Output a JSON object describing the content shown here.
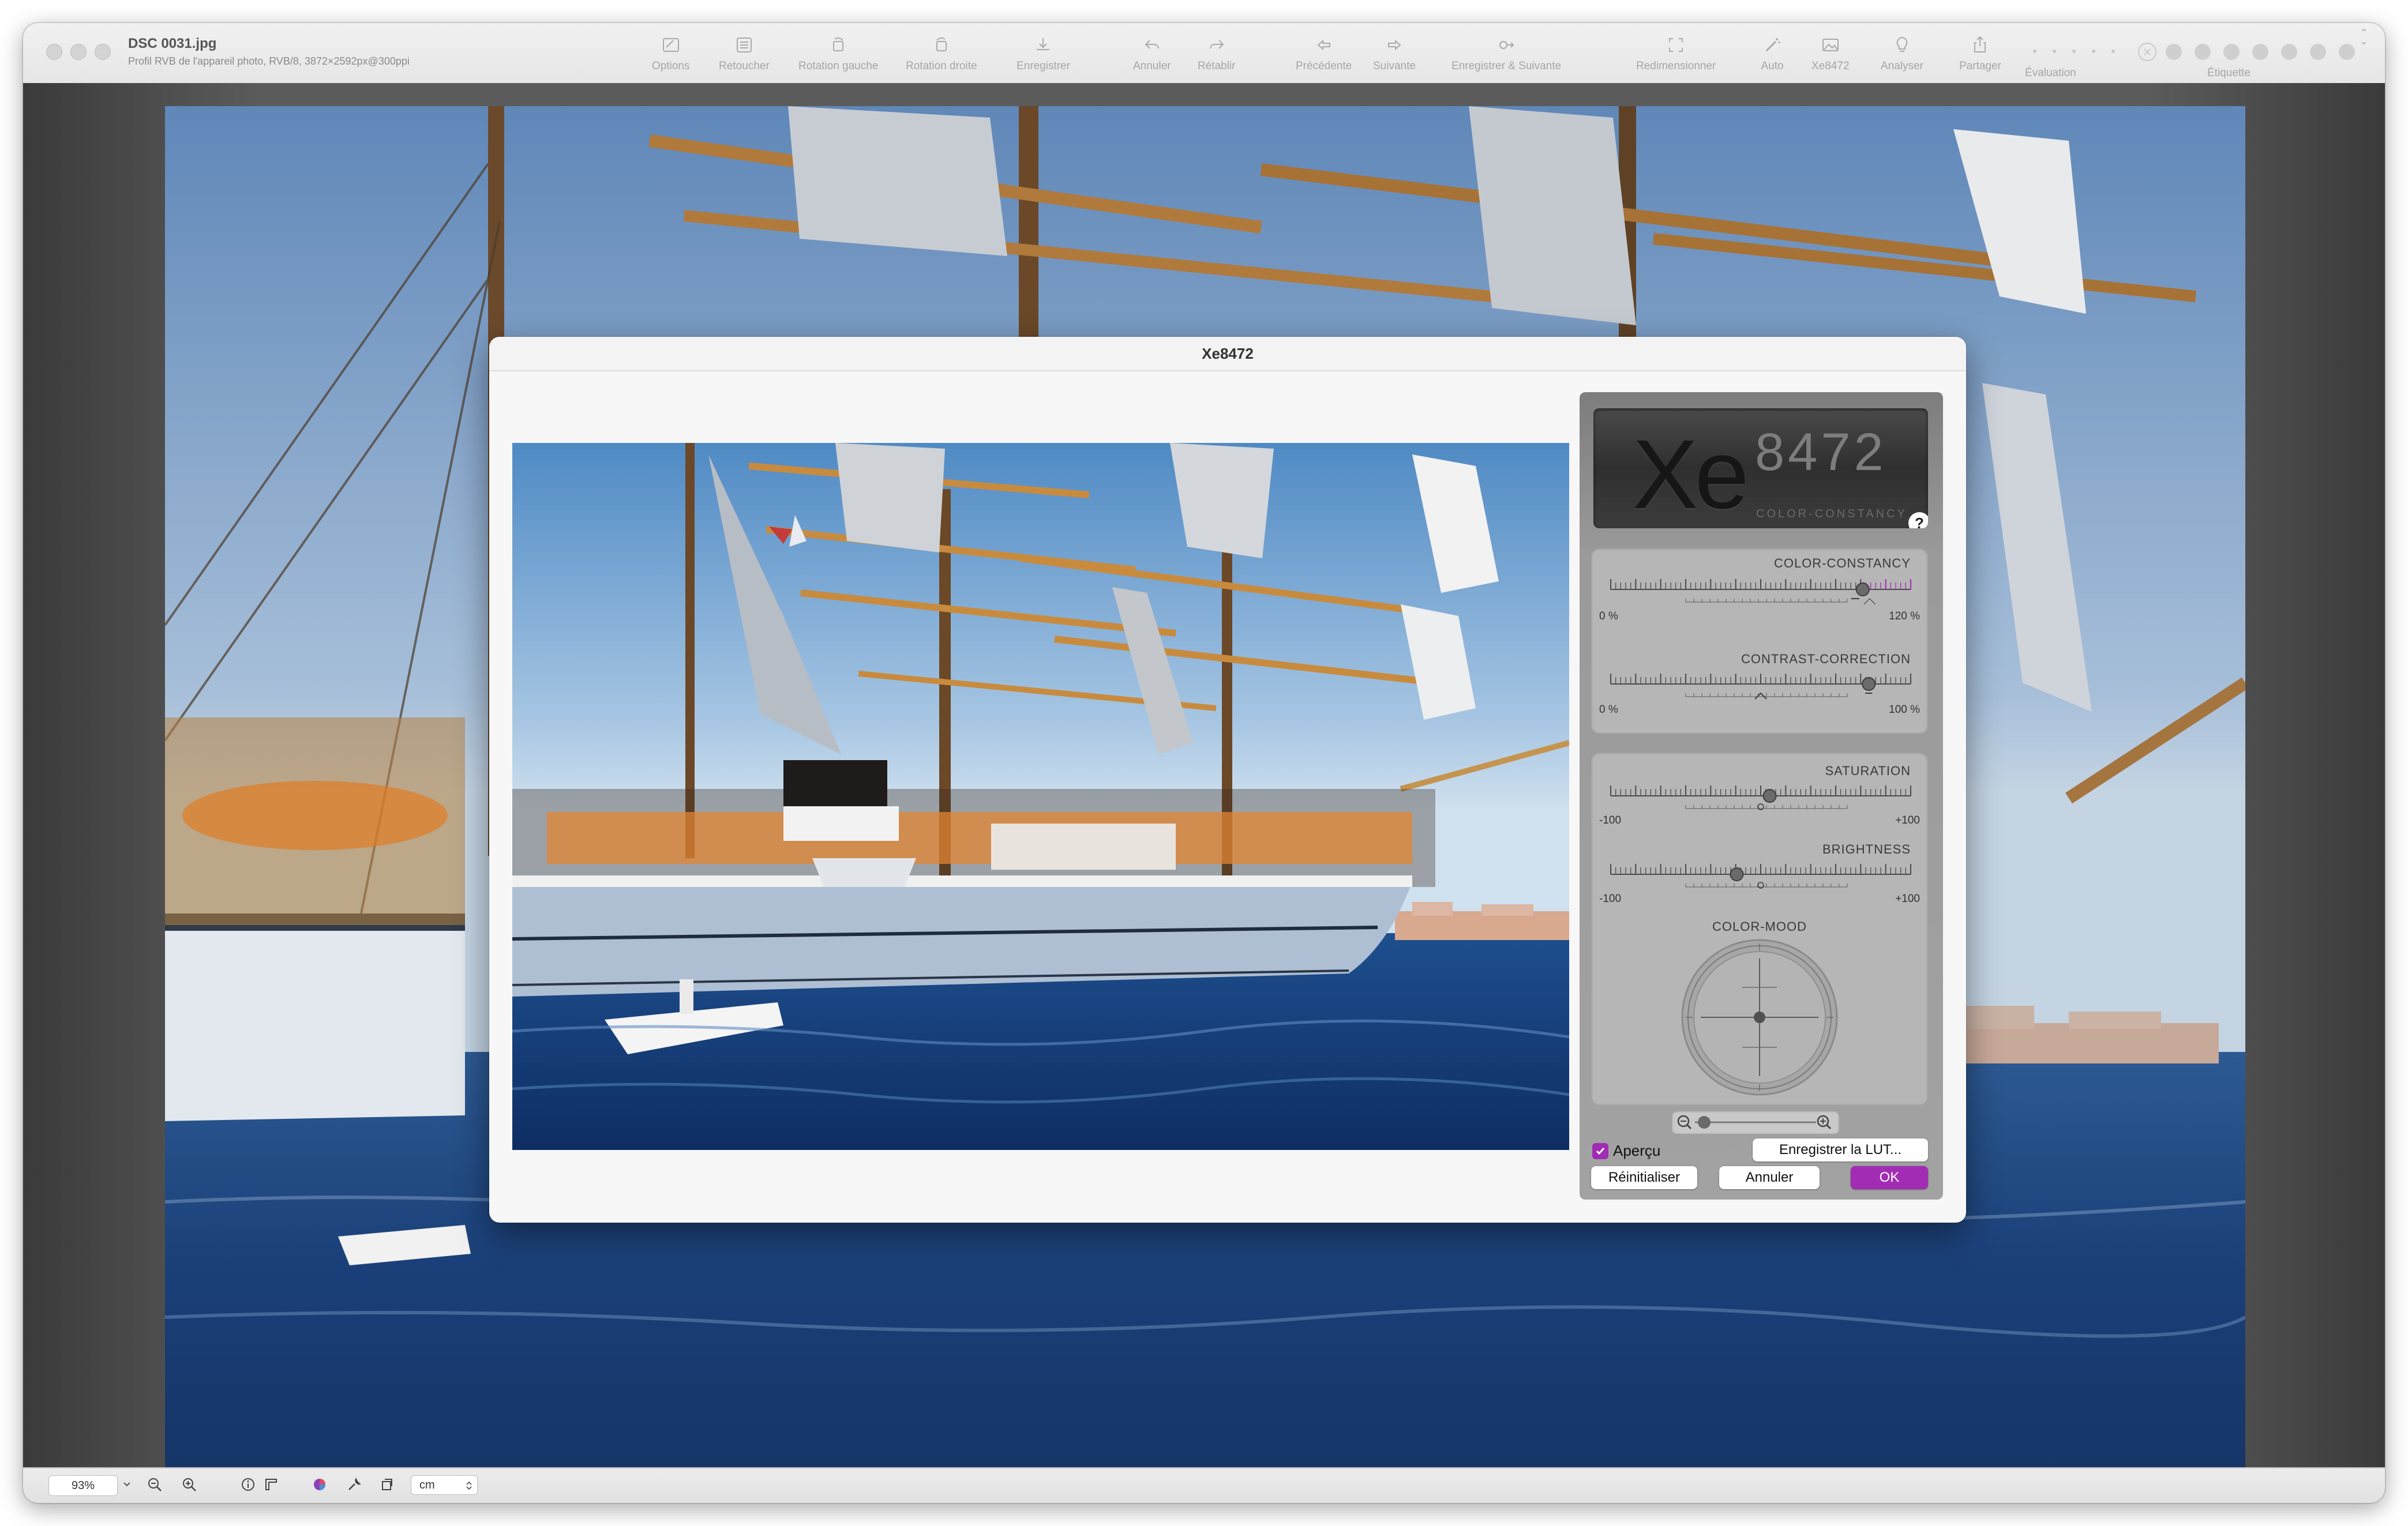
{
  "window": {
    "title": "DSC 0031.jpg",
    "subtitle": "Profil RVB de l'appareil photo, RVB/8, 3872×2592px@300ppi"
  },
  "toolbar": {
    "items": [
      {
        "label": "Options",
        "icon": "options-icon"
      },
      {
        "label": "Retoucher",
        "icon": "retouch-icon"
      },
      {
        "label": "Rotation gauche",
        "icon": "rotate-left-icon"
      },
      {
        "label": "Rotation droite",
        "icon": "rotate-right-icon"
      },
      {
        "label": "Enregistrer",
        "icon": "save-icon"
      },
      {
        "label": "Annuler",
        "icon": "undo-icon"
      },
      {
        "label": "Rétablir",
        "icon": "redo-icon"
      },
      {
        "label": "Précédente",
        "icon": "previous-icon"
      },
      {
        "label": "Suivante",
        "icon": "next-icon"
      },
      {
        "label": "Enregistrer & Suivante",
        "icon": "save-next-icon"
      },
      {
        "label": "Redimensionner",
        "icon": "resize-icon"
      },
      {
        "label": "Auto",
        "icon": "magic-wand-icon"
      },
      {
        "label": "Xe8472",
        "icon": "image-icon"
      },
      {
        "label": "Analyser",
        "icon": "lightbulb-icon"
      },
      {
        "label": "Partager",
        "icon": "share-icon"
      }
    ],
    "rating_label": "Évaluation",
    "tag_label": "Étiquette",
    "accent_colors": [
      "#d0d0d0",
      "#c8c8c8"
    ]
  },
  "dialog": {
    "title": "Xe8472",
    "panel": {
      "logo_xe": "Xe",
      "logo_num": "8472",
      "logo_tag": "COLOR-CONSTANCY",
      "help": "?",
      "color_constancy": {
        "title": "COLOR-CONSTANCY",
        "min": "0 %",
        "max": "120 %",
        "value_pct": 84
      },
      "contrast_correction": {
        "title": "CONTRAST-CORRECTION",
        "min": "0 %",
        "max": "100 %",
        "value_pct": 86
      },
      "saturation": {
        "title": "SATURATION",
        "min": "-100",
        "max": "+100",
        "value_pct": 53
      },
      "brightness": {
        "title": "BRIGHTNESS",
        "min": "-100",
        "max": "+100",
        "value_pct": 42
      },
      "color_mood": {
        "title": "COLOR-MOOD"
      },
      "preview_checkbox": {
        "label": "Aperçu",
        "checked": true
      },
      "save_lut": "Enregistrer la LUT...",
      "reset": "Réinitialiser",
      "cancel": "Annuler",
      "ok": "OK",
      "accent": "#a32cb5"
    }
  },
  "statusbar": {
    "zoom": "93%",
    "unit": "cm"
  }
}
